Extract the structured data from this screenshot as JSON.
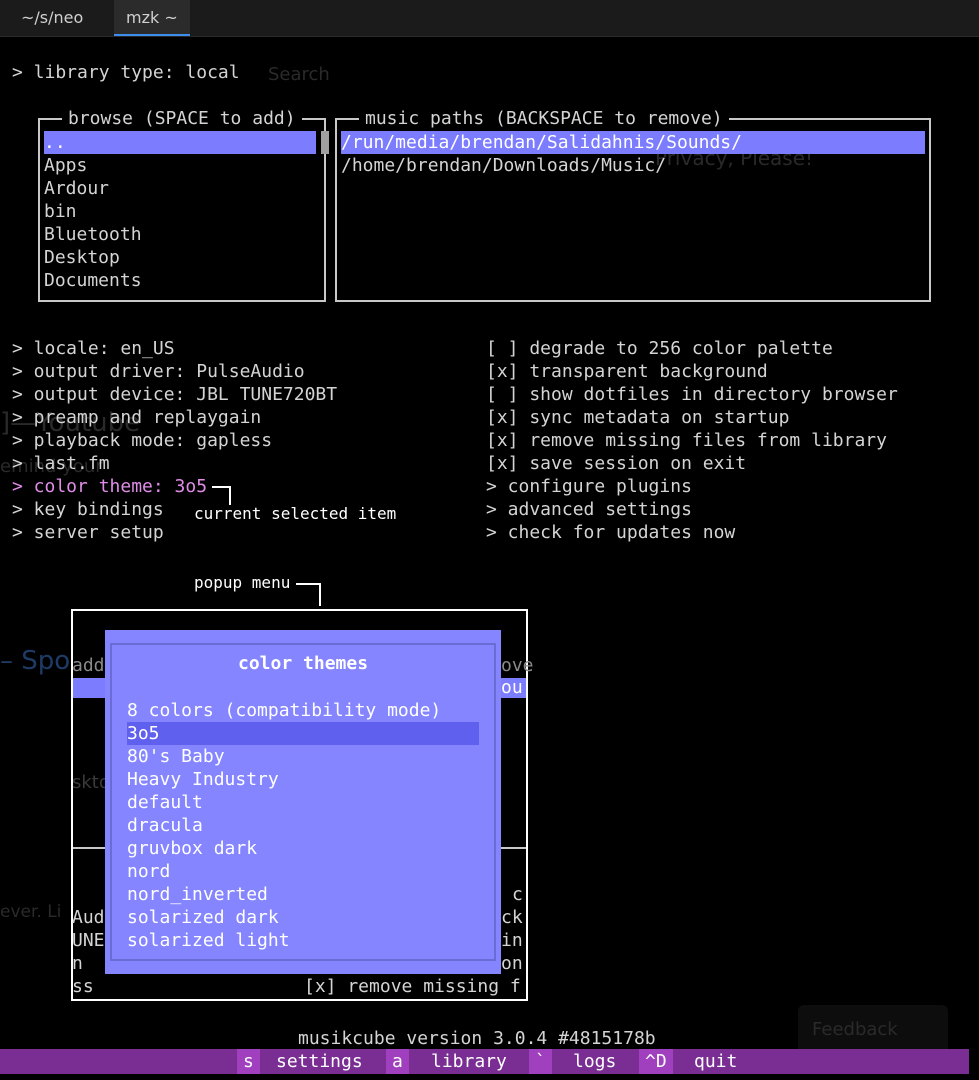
{
  "tabs": [
    "~/s/neo",
    "mzk ~"
  ],
  "ghost": {
    "search_placeholder": "Search",
    "privacy": "Privacy, Please!",
    "youtube": "]—Youtube",
    "reminder": "emind your",
    "spotify": "– Spo",
    "desktop": "skto",
    "clever": "ever. Li",
    "feedback": "Feedback"
  },
  "library_type": "> library type: local",
  "browse": {
    "title": "browse (SPACE to add)",
    "items": [
      "..",
      "Apps",
      "Ardour",
      "bin",
      "Bluetooth",
      "Desktop",
      "Documents"
    ]
  },
  "music_paths": {
    "title": "music paths (BACKSPACE to remove)",
    "items": [
      "/run/media/brendan/Salidahnis/Sounds/",
      "/home/brendan/Downloads/Music/"
    ]
  },
  "left_settings": [
    "> locale: en_US",
    "> output driver: PulseAudio",
    "> output device: JBL TUNE720BT",
    "> preamp and replaygain",
    "> playback mode: gapless",
    "> last.fm",
    "> color theme: 3o5",
    "> key bindings",
    "> server setup"
  ],
  "right_settings": [
    "[ ] degrade to 256 color palette",
    "[x] transparent background",
    "[ ] show dotfiles in directory browser",
    "[x] sync metadata on startup",
    "[x] remove missing files from library",
    "[x] save session on exit",
    "> configure plugins",
    "> advanced settings",
    "> check for updates now"
  ],
  "annotations": {
    "selected": "current selected item",
    "popup": "popup menu"
  },
  "background_fragments": {
    "add": "add",
    "ove": "ove",
    "ou": "ou",
    "c": "c",
    "ck": "ck",
    "in": "in",
    "on": "on",
    "aud": "Aud",
    "une": "UNE",
    "n": "n",
    "ss": "ss",
    "remove_missing": "[x] remove missing f"
  },
  "popup": {
    "title": "color themes",
    "items": [
      "8 colors (compatibility mode)",
      "3o5",
      "80's Baby",
      "Heavy Industry",
      "default",
      "dracula",
      "gruvbox dark",
      "nord",
      "nord_inverted",
      "solarized dark",
      "solarized light"
    ],
    "selected_index": 1
  },
  "version": "musikcube version 3.0.4 #4815178b",
  "statusbar": [
    {
      "key": "s",
      "label": "settings"
    },
    {
      "key": "a",
      "label": "library"
    },
    {
      "key": "`",
      "label": "logs"
    },
    {
      "key": "^D",
      "label": "quit"
    }
  ],
  "colors": {
    "selection": "#7c7cff",
    "accent": "#e08ce8",
    "popup_bg": "#8585ff",
    "statusbar": "#7a2e94"
  }
}
